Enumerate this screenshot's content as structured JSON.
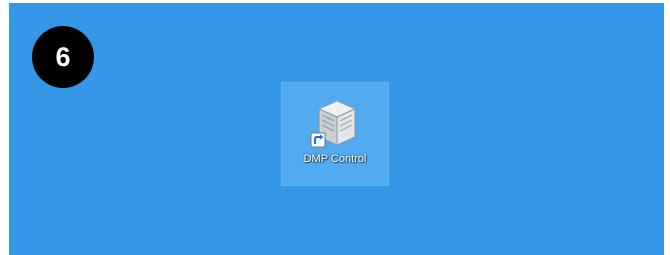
{
  "step_number": "6",
  "desktop": {
    "background_color": "#3497e8",
    "shortcut": {
      "label": "DMP Control",
      "icon": "dmp-control-app-icon",
      "shortcut_badge_icon": "shortcut-arrow-icon"
    }
  }
}
